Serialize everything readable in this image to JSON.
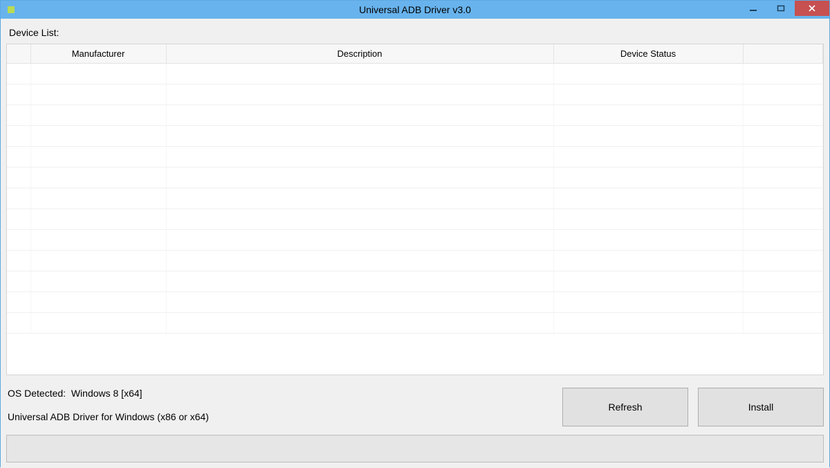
{
  "window": {
    "title": "Universal ADB Driver v3.0"
  },
  "panel": {
    "device_list_label": "Device List:"
  },
  "table": {
    "columns": {
      "col0": "",
      "manufacturer": "Manufacturer",
      "description": "Description",
      "status": "Device Status",
      "col4": ""
    }
  },
  "status": {
    "os_label": "OS Detected:",
    "os_value": "Windows 8  [x64]",
    "driver_desc": "Universal ADB Driver for Windows (x86 or x64)"
  },
  "buttons": {
    "refresh": "Refresh",
    "install": "Install"
  }
}
